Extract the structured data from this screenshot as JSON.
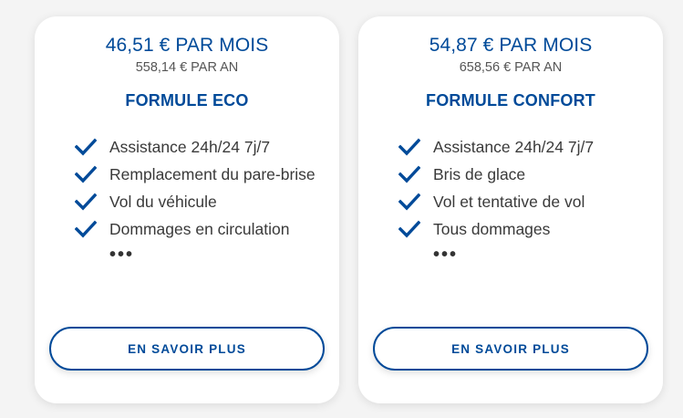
{
  "plans": [
    {
      "price_month": "46,51 € PAR MOIS",
      "price_year": "558,14 € PAR AN",
      "name": "FORMULE ECO",
      "features": [
        "Assistance 24h/24 7j/7",
        "Remplacement du pare-brise",
        "Vol du véhicule",
        "Dommages en circulation"
      ],
      "more": "•••",
      "cta_label": "EN SAVOIR PLUS"
    },
    {
      "price_month": "54,87 € PAR MOIS",
      "price_year": "658,56 € PAR AN",
      "name": "FORMULE CONFORT",
      "features": [
        "Assistance 24h/24 7j/7",
        "Bris de glace",
        "Vol et tentative de vol",
        "Tous dommages"
      ],
      "more": "•••",
      "cta_label": "EN SAVOIR PLUS"
    }
  ],
  "colors": {
    "brand_blue": "#004a99",
    "text_gray": "#3a3a3a",
    "background": "#f4f4f4",
    "card": "#ffffff"
  },
  "icons": {
    "feature": "check-icon"
  }
}
